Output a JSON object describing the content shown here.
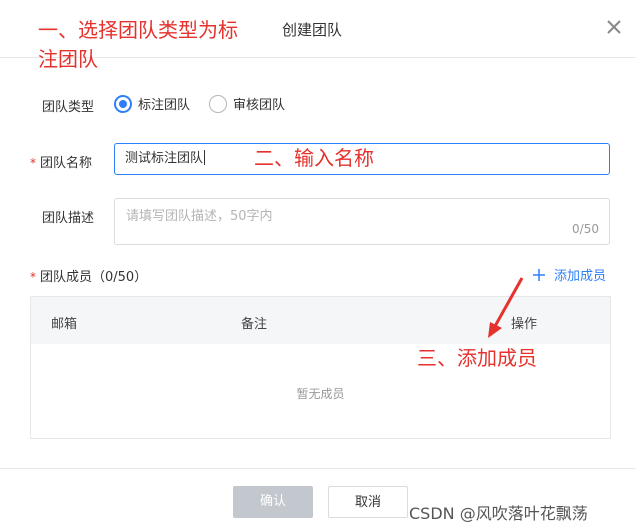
{
  "dialog": {
    "title": "创建团队"
  },
  "annotations": {
    "step1_line1": "一、选择团队类型为标",
    "step1_line2": "注团队",
    "step2": "二、输入名称",
    "step3": "三、添加成员"
  },
  "form": {
    "team_type_label": "团队类型",
    "team_type_options": [
      "标注团队",
      "审核团队"
    ],
    "team_type_selected": "标注团队",
    "team_name_label": "团队名称",
    "team_name_value": "测试标注团队",
    "team_desc_label": "团队描述",
    "team_desc_placeholder": "请填写团队描述，50字内",
    "team_desc_count": "0/50",
    "members_label": "团队成员（0/50）",
    "add_member_label": "添加成员"
  },
  "members_table": {
    "columns": [
      "邮箱",
      "备注",
      "操作"
    ],
    "empty_text": "暂无成员"
  },
  "footer": {
    "confirm_label": "确认",
    "cancel_label": "取消"
  },
  "watermark": "CSDN @风吹落叶花飘荡",
  "colors": {
    "accent": "#2d7ff9",
    "annotation": "#e5322d",
    "required": "#e5322d",
    "disabled_button": "#c3c7ce"
  },
  "icons": {
    "close": "close-icon",
    "add": "plus-icon",
    "annotation_arrow": "arrow-icon"
  }
}
